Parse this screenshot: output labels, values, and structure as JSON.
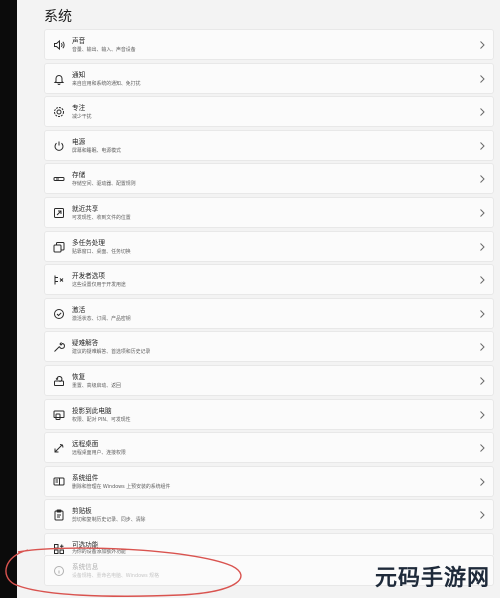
{
  "page_title": "系统",
  "items": [
    {
      "icon": "speaker-icon",
      "title": "声音",
      "subtitle": "音量、输出、输入、声音设备"
    },
    {
      "icon": "bell-icon",
      "title": "通知",
      "subtitle": "来自应用和系统的通知、免打扰"
    },
    {
      "icon": "focus-icon",
      "title": "专注",
      "subtitle": "减少干扰"
    },
    {
      "icon": "power-icon",
      "title": "电源",
      "subtitle": "屏幕和睡眠、电源模式"
    },
    {
      "icon": "storage-icon",
      "title": "存储",
      "subtitle": "存储空间、驱动器、配置规则"
    },
    {
      "icon": "nearby-share-icon",
      "title": "就近共享",
      "subtitle": "可发现性、收到文件的位置"
    },
    {
      "icon": "multitasking-icon",
      "title": "多任务处理",
      "subtitle": "贴靠窗口、桌面、任务切换"
    },
    {
      "icon": "developer-icon",
      "title": "开发者选项",
      "subtitle": "这些设置仅用于开发用途"
    },
    {
      "icon": "activation-icon",
      "title": "激活",
      "subtitle": "激活状态、订阅、产品密钥"
    },
    {
      "icon": "troubleshoot-icon",
      "title": "疑难解答",
      "subtitle": "建议的疑难解答、首选项和历史记录"
    },
    {
      "icon": "recovery-icon",
      "title": "恢复",
      "subtitle": "重置、高级启动、返回"
    },
    {
      "icon": "project-icon",
      "title": "投影到此电脑",
      "subtitle": "权限、配对 PIN、可发现性"
    },
    {
      "icon": "remote-desktop-icon",
      "title": "远程桌面",
      "subtitle": "远程桌面用户、连接权限"
    },
    {
      "icon": "system-components-icon",
      "title": "系统组件",
      "subtitle": "删除和管理在 Windows 上预安装的系统组件"
    },
    {
      "icon": "clipboard-icon",
      "title": "剪贴板",
      "subtitle": "剪切和复制历史记录、同步、清除"
    },
    {
      "icon": "optional-features-icon",
      "title": "可选功能",
      "subtitle": "为你的设备添加额外功能"
    },
    {
      "icon": "info-icon",
      "title": "系统信息",
      "subtitle": "设备规格、重命名电脑、Windows 规格"
    }
  ],
  "watermark": "元码手游网",
  "colors": {
    "annotation": "#d9534f",
    "left_bar": "#0b0b0b",
    "background": "#f3f3f3"
  }
}
